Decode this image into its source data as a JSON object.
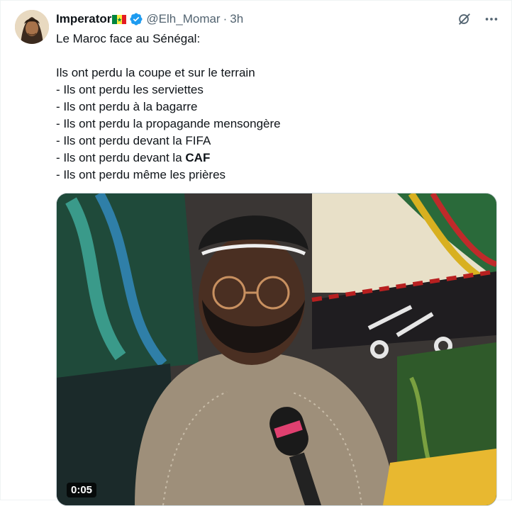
{
  "tweet": {
    "author_name": "Imperator",
    "handle": "@Elh_Momar",
    "separator": "·",
    "time": "3h",
    "body_lines": [
      "Le Maroc face au Sénégal:",
      "",
      "Ils ont perdu la coupe et sur le terrain",
      "- Ils ont perdu les serviettes",
      "- Ils ont perdu à la bagarre",
      "- Ils ont perdu la propagande mensongère",
      "- Ils ont perdu devant la FIFA",
      "- Ils ont perdu devant la ",
      "CAF",
      "- Ils ont perdu même les prières"
    ],
    "media": {
      "duration": "0:05"
    }
  },
  "icons": {
    "flag": "senegal-flag-icon",
    "verified": "verified-badge-icon",
    "grok": "grok-icon",
    "more": "more-icon"
  },
  "colors": {
    "verified": "#1d9bf0",
    "text_secondary": "#536471",
    "flag_green": "#00853f",
    "flag_yellow": "#fdef42",
    "flag_red": "#e31b23"
  }
}
